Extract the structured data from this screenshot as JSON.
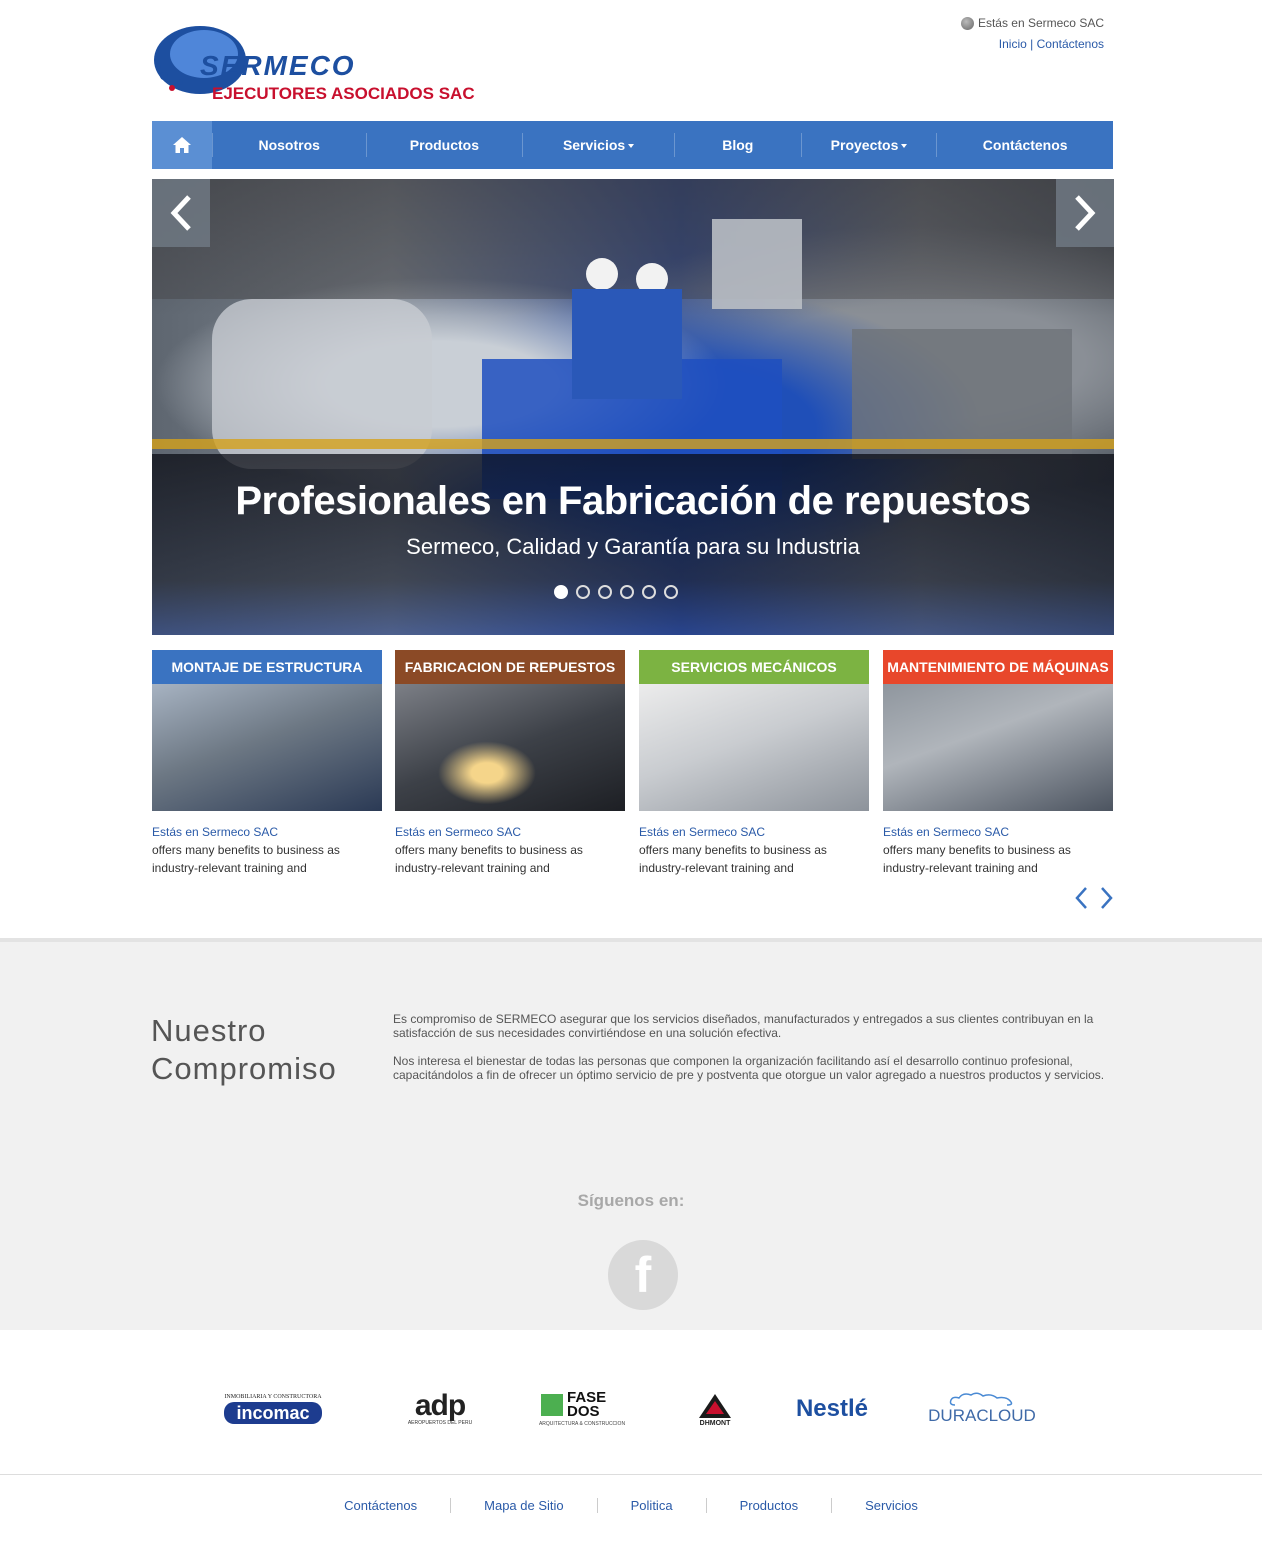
{
  "header": {
    "logo_text": "SERMECO",
    "logo_subtitle": "EJECUTORES ASOCIADOS SAC",
    "location_text": "Estás en Sermeco SAC",
    "top_links": [
      "Inicio",
      "Contáctenos"
    ],
    "top_links_separator": "|"
  },
  "nav": {
    "home_icon": "home-icon",
    "items": [
      "Nosotros",
      "Productos",
      "Servicios",
      "Blog",
      "Proyectos",
      "Contáctenos"
    ]
  },
  "slider": {
    "headline": "Profesionales en Fabricación de repuestos",
    "subheadline": "Sermeco, Calidad y Garantía para su Industria",
    "slide_count": 6,
    "active_slide": 1
  },
  "cards": [
    {
      "title": "MONTAJE DE ESTRUCTURA",
      "color": "#3a73c1",
      "link": "Estás en Sermeco SAC",
      "desc": "offers many benefits to business as industry-relevant training and"
    },
    {
      "title": "FABRICACION DE REPUESTOS",
      "color": "#8b4a26",
      "link": "Estás en Sermeco SAC",
      "desc": "offers many benefits to business as industry-relevant training and"
    },
    {
      "title": "SERVICIOS MECÁNICOS",
      "color": "#7cb342",
      "link": "Estás en Sermeco SAC",
      "desc": "offers many benefits to business as industry-relevant training and"
    },
    {
      "title": "MANTENIMIENTO DE MÁQUINAS",
      "color": "#e8472b",
      "link": "Estás en Sermeco SAC",
      "desc": "offers many benefits to business as industry-relevant training and"
    }
  ],
  "commitment": {
    "title_line1": "Nuestro",
    "title_line2": "Compromiso",
    "paragraph1": "Es compromiso de SERMECO asegurar que los servicios diseñados, manufacturados y entregados a sus clientes contribuyan en la satisfacción de sus necesidades convirtiéndose en una solución efectiva.",
    "paragraph2": "Nos interesa el bienestar de todas las personas que componen la organización facilitando así el desarrollo continuo profesional, capacitándolos a fin de ofrecer un óptimo servicio de pre y postventa que otorgue un valor agregado a nuestros productos y servicios."
  },
  "social": {
    "follow_label": "Síguenos en:",
    "icon": "facebook-icon"
  },
  "partners": {
    "incomac_top": "INMOBILIARIA Y CONSTRUCTORA",
    "incomac": "incomac",
    "adp": "adp",
    "adp_sub": "AEROPUERTOS DEL PERU",
    "fasedos": "FASE DOS",
    "fasedos_sub": "ARQUITECTURA & CONSTRUCCION",
    "dhmont": "DHMONT",
    "nestle": "Nestlé",
    "duracloud": "DURACLOUD"
  },
  "footer": {
    "links": [
      "Contáctenos",
      "Mapa de Sitio",
      "Politica",
      "Productos",
      "Servicios"
    ]
  }
}
